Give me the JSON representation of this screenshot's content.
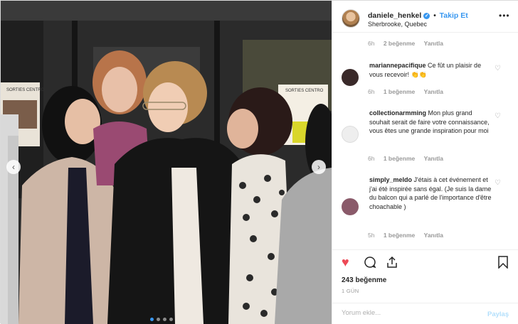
{
  "header": {
    "username": "daniele_henkel",
    "separator": "•",
    "follow_label": "Takip Et",
    "location": "Sherbrooke, Quebec",
    "more": "•••"
  },
  "caption_meta": {
    "time": "6h",
    "likes": "2 beğenme",
    "reply": "Yanıtla"
  },
  "comments": [
    {
      "username": "mariannepacifique",
      "text": " Ce fût un plaisir de vous recevoir! 👏👏",
      "time": "6h",
      "likes": "1 beğenme",
      "reply": "Yanıtla",
      "avatar_color": "#3a2a2a"
    },
    {
      "username": "collectionarmming",
      "text": " Mon plus grand souhait serait de faire votre connaissance, vous êtes une grande inspiration pour moi",
      "time": "6h",
      "likes": "1 beğenme",
      "reply": "Yanıtla",
      "avatar_color": "#e8e8e8"
    },
    {
      "username": "simply_meldo",
      "text": " J'étais à cet événement et j'ai été inspirée sans égal. (Je suis la dame du balcon qui a parlé de l'importance d'être choachable )",
      "time": "5h",
      "likes": "1 beğenme",
      "reply": "Yanıtla",
      "avatar_color": "#8a5a6a"
    }
  ],
  "actions": {
    "like_icon": "heart-filled-icon",
    "comment_icon": "comment-bubble-icon",
    "share_icon": "share-icon",
    "save_icon": "bookmark-icon",
    "like_color": "#ed4956"
  },
  "like_count": "243 beğenme",
  "time_ago": "1 GÜN",
  "comment_input": {
    "placeholder": "Yorum ekle...",
    "post_label": "Paylaş"
  },
  "photo": {
    "sign_left": "SORTIES CENTRO",
    "sign_right": "SORTIES CENTRO"
  }
}
